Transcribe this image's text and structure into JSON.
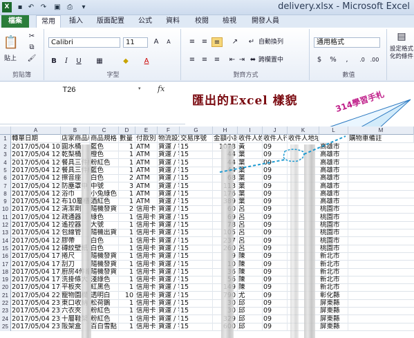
{
  "window": {
    "title": "delivery.xlsx - Microsoft Excel"
  },
  "tabs": [
    "檔案",
    "常用",
    "插入",
    "版面配置",
    "公式",
    "資料",
    "校閱",
    "檢視",
    "開發人員"
  ],
  "ribbon": {
    "paste": "貼上",
    "clipboard_label": "剪貼簿",
    "font_name": "Calibri",
    "font_size": "11",
    "font_label": "字型",
    "wrap_text": "自動換列",
    "merge": "跨欄置中",
    "align_label": "對齊方式",
    "number_format": "通用格式",
    "number_label": "數值",
    "cond_format": "設定格式化的條件"
  },
  "formula_bar": {
    "name_box": "T26",
    "fx": "fx"
  },
  "banner": {
    "title": "匯出的Excel 樣貌",
    "note": "314學習手札"
  },
  "columns": [
    "A",
    "B",
    "C",
    "D",
    "E",
    "F",
    "G",
    "H",
    "I",
    "J",
    "K",
    "L",
    "M"
  ],
  "headers": [
    "轉單日期",
    "店家商品料號",
    "商品規格",
    "數量",
    "付款別",
    "物流設定",
    "交易序號",
    "金額小計",
    "收件人姓名",
    "收件人行動電話",
    "收件人地址",
    "",
    "購物車備註"
  ],
  "rows": [
    {
      "n": "2",
      "a": "2017/05/04 10:52",
      "b": "圓水桶",
      "c": "藍色",
      "d": "1",
      "e": "ATM",
      "f": "貨運 / 宅配",
      "g": "15",
      "h": "1078",
      "i": "黃",
      "j": "09",
      "l": "高雄市"
    },
    {
      "n": "3",
      "a": "2017/05/04 12:32",
      "b": "乾梨桶",
      "c": "橙色",
      "d": "1",
      "e": "ATM",
      "f": "貨運 / 宅配",
      "g": "15",
      "h": "44",
      "i": "葉",
      "j": "09",
      "l": "高雄市"
    },
    {
      "n": "4",
      "a": "2017/05/04 12:32",
      "b": "餐具三件組",
      "c": "粉紅色",
      "d": "1",
      "e": "ATM",
      "f": "貨運 / 宅配",
      "g": "15",
      "h": "44",
      "i": "葉",
      "j": "09",
      "l": "高雄市"
    },
    {
      "n": "5",
      "a": "2017/05/04 12:32",
      "b": "餐具三件組",
      "c": "藍色",
      "d": "1",
      "e": "ATM",
      "f": "貨運 / 宅配",
      "g": "15",
      "h": "44",
      "i": "葉",
      "j": "09",
      "l": "高雄市"
    },
    {
      "n": "6",
      "a": "2017/05/04 12:32",
      "b": "擦音座",
      "c": "白色",
      "d": "2",
      "e": "ATM",
      "f": "貨運 / 宅配",
      "g": "15",
      "h": "68",
      "i": "葉",
      "j": "09",
      "l": "高雄市"
    },
    {
      "n": "7",
      "a": "2017/05/04 12:32",
      "b": "防塵罩中",
      "c": "中號",
      "d": "3",
      "e": "ATM",
      "f": "貨運 / 宅配",
      "g": "15",
      "h": "113",
      "i": "葉",
      "j": "09",
      "l": "高雄市"
    },
    {
      "n": "8",
      "a": "2017/05/04 12:32",
      "b": "浴巾",
      "c": "小兔綠色",
      "d": "1",
      "e": "ATM",
      "f": "貨運 / 宅配",
      "g": "15",
      "h": "176",
      "i": "葉",
      "j": "09",
      "l": "高雄市"
    },
    {
      "n": "9",
      "a": "2017/05/04 12:32",
      "b": "布10層櫃",
      "c": "酒紅色",
      "d": "1",
      "e": "ATM",
      "f": "貨運 / 宅配",
      "g": "15",
      "h": "389",
      "i": "葉",
      "j": "09",
      "l": "高雄市"
    },
    {
      "n": "10",
      "a": "2017/05/04 12:41",
      "b": "清潔劑",
      "c": "隨機發貨",
      "d": "2",
      "e": "信用卡",
      "f": "貨運 / 宅配",
      "g": "15",
      "h": "60",
      "i": "呂",
      "j": "09",
      "l": "桃園市"
    },
    {
      "n": "11",
      "a": "2017/05/04 12:41",
      "b": "疏通器",
      "c": "綠色",
      "d": "1",
      "e": "信用卡",
      "f": "貨運 / 宅配",
      "g": "15",
      "h": "69",
      "i": "呂",
      "j": "09",
      "l": "桃園市"
    },
    {
      "n": "12",
      "a": "2017/05/04 12:41",
      "b": "遙控器",
      "c": "大號",
      "d": "1",
      "e": "信用卡",
      "f": "貨運 / 宅配",
      "g": "15",
      "h": "78",
      "i": "呂",
      "j": "09",
      "l": "桃園市"
    },
    {
      "n": "13",
      "a": "2017/05/04 12:41",
      "b": "包線管",
      "c": "隨機出貨",
      "d": "1",
      "e": "信用卡",
      "f": "貨運 / 宅配",
      "g": "15",
      "h": "105",
      "i": "呂",
      "j": "09",
      "l": "桃園市"
    },
    {
      "n": "14",
      "a": "2017/05/04 12:41",
      "b": "膠帶",
      "c": "白色",
      "d": "1",
      "e": "信用卡",
      "f": "貨運 / 宅配",
      "g": "15",
      "h": "237",
      "i": "呂",
      "j": "09",
      "l": "桃園市"
    },
    {
      "n": "15",
      "a": "2017/05/04 12:41",
      "b": "磚紋壁紙",
      "c": "白色",
      "d": "1",
      "e": "信用卡",
      "f": "貨運 / 宅配",
      "g": "15",
      "h": "260",
      "i": "呂",
      "j": "09",
      "l": "桃園市"
    },
    {
      "n": "16",
      "a": "2017/05/04 17:28",
      "b": "捲尺",
      "c": "隨機發貨",
      "d": "1",
      "e": "信用卡",
      "f": "貨運 / 宅配",
      "g": "15",
      "h": "9",
      "i": "陳",
      "j": "09",
      "l": "新北市"
    },
    {
      "n": "17",
      "a": "2017/05/04 17:28",
      "b": "刮刀",
      "c": "隨機發貨",
      "d": "1",
      "e": "信用卡",
      "f": "貨運 / 宅配",
      "g": "15",
      "h": "10",
      "i": "陳",
      "j": "09",
      "l": "新北市"
    },
    {
      "n": "18",
      "a": "2017/05/04 17:28",
      "b": "廚房4件組",
      "c": "隨機發貨",
      "d": "1",
      "e": "信用卡",
      "f": "貨運 / 宅配",
      "g": "15",
      "h": "36",
      "i": "陳",
      "j": "09",
      "l": "新北市"
    },
    {
      "n": "19",
      "a": "2017/05/04 17:28",
      "b": "洗掛條大",
      "c": "淺綠色",
      "d": "1",
      "e": "信用卡",
      "f": "貨運 / 宅配",
      "g": "15",
      "h": "56",
      "i": "陳",
      "j": "09",
      "l": "新北市"
    },
    {
      "n": "20",
      "a": "2017/05/04 17:28",
      "b": "平板夾",
      "c": "紅黑色",
      "d": "1",
      "e": "信用卡",
      "f": "貨運 / 宅配",
      "g": "15",
      "h": "149",
      "i": "陳",
      "j": "09",
      "l": "新北市"
    },
    {
      "n": "21",
      "a": "2017/05/04 22:01",
      "b": "寵物園欄",
      "c": "透明白",
      "d": "10",
      "e": "信用卡",
      "f": "貨運 / 宅配",
      "g": "15",
      "h": "790",
      "i": "尤",
      "j": "09",
      "l": "彰化縣"
    },
    {
      "n": "22",
      "a": "2017/05/04 23:01",
      "b": "東口收納",
      "c": "松荷鵝",
      "d": "1",
      "e": "信用卡",
      "f": "貨運 / 宅配",
      "g": "15",
      "h": "30",
      "i": "邱",
      "j": "09",
      "l": "屏東縣"
    },
    {
      "n": "23",
      "a": "2017/05/04 23:01",
      "b": "六衣夾",
      "c": "粉紅色",
      "d": "1",
      "e": "信用卡",
      "f": "貨運 / 宅配",
      "g": "15",
      "h": "30",
      "i": "邱",
      "j": "09",
      "l": "屏東縣"
    },
    {
      "n": "24",
      "a": "2017/05/04 23:01",
      "b": "十層鞋架",
      "c": "粉紅色",
      "d": "1",
      "e": "信用卡",
      "f": "貨運 / 宅配",
      "g": "15",
      "h": "329",
      "i": "邱",
      "j": "09",
      "l": "屏東縣"
    },
    {
      "n": "25",
      "a": "2017/05/04 23:01",
      "b": "阪架盒",
      "c": "百白雪點",
      "d": "1",
      "e": "信用卡",
      "f": "貨運 / 宅配",
      "g": "15",
      "h": "600",
      "i": "邱",
      "j": "09",
      "l": "屏東縣"
    }
  ],
  "accent": "#2a7d3a"
}
